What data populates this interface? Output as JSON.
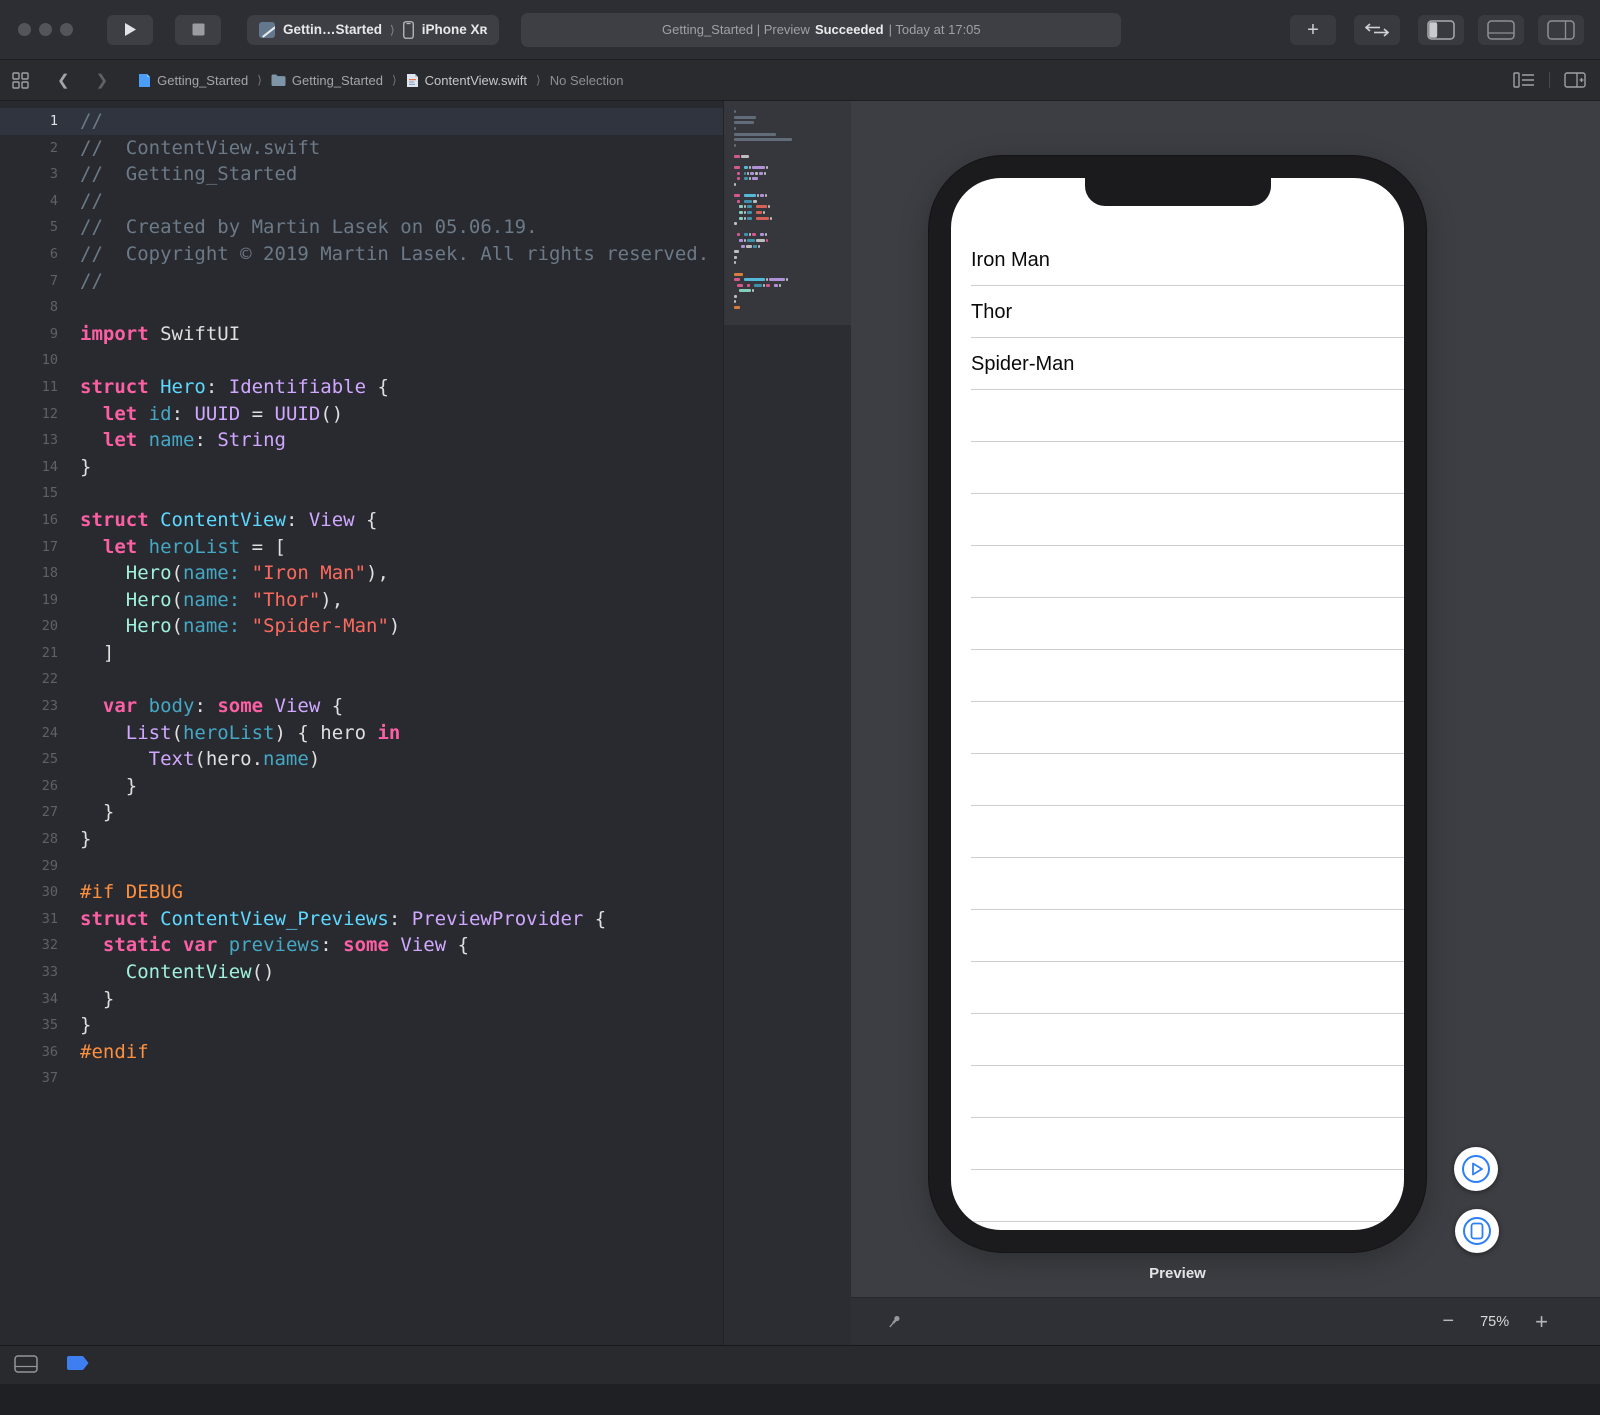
{
  "toolbar": {
    "scheme_app": "Gettin…Started",
    "scheme_chevron": "⟩",
    "scheme_device": "iPhone Xʀ",
    "status_left": "Getting_Started | Preview",
    "status_bold": "Succeeded",
    "status_right": "| Today at 17:05"
  },
  "jumpbar": {
    "back": "❮",
    "forward": "❯",
    "sep": "⟩",
    "crumb_project": "Getting_Started",
    "crumb_group": "Getting_Started",
    "crumb_file": "ContentView.swift",
    "crumb_selection": "No Selection"
  },
  "editor": {
    "current_line": 1,
    "lines": [
      {
        "n": 1,
        "t": [
          [
            "c",
            "//"
          ]
        ]
      },
      {
        "n": 2,
        "t": [
          [
            "c",
            "//  ContentView.swift"
          ]
        ]
      },
      {
        "n": 3,
        "t": [
          [
            "c",
            "//  Getting_Started"
          ]
        ]
      },
      {
        "n": 4,
        "t": [
          [
            "c",
            "//"
          ]
        ]
      },
      {
        "n": 5,
        "t": [
          [
            "c",
            "//  Created by Martin Lasek on 05.06.19."
          ]
        ]
      },
      {
        "n": 6,
        "t": [
          [
            "c",
            "//  Copyright © 2019 Martin Lasek. All rights reserved."
          ]
        ]
      },
      {
        "n": 7,
        "t": [
          [
            "c",
            "//"
          ]
        ]
      },
      {
        "n": 8,
        "t": []
      },
      {
        "n": 9,
        "t": [
          [
            "k",
            "import"
          ],
          [
            "p",
            " SwiftUI"
          ]
        ]
      },
      {
        "n": 10,
        "t": []
      },
      {
        "n": 11,
        "t": [
          [
            "k",
            "struct"
          ],
          [
            "p",
            " "
          ],
          [
            "m",
            "Hero"
          ],
          [
            "p",
            ": "
          ],
          [
            "t",
            "Identifiable"
          ],
          [
            "p",
            " {"
          ]
        ]
      },
      {
        "n": 12,
        "t": [
          [
            "p",
            "  "
          ],
          [
            "k",
            "let"
          ],
          [
            "p",
            " "
          ],
          [
            "v",
            "id"
          ],
          [
            "p",
            ": "
          ],
          [
            "t",
            "UUID"
          ],
          [
            "p",
            " = "
          ],
          [
            "t",
            "UUID"
          ],
          [
            "p",
            "()"
          ]
        ]
      },
      {
        "n": 13,
        "t": [
          [
            "p",
            "  "
          ],
          [
            "k",
            "let"
          ],
          [
            "p",
            " "
          ],
          [
            "v",
            "name"
          ],
          [
            "p",
            ": "
          ],
          [
            "t",
            "String"
          ]
        ]
      },
      {
        "n": 14,
        "t": [
          [
            "p",
            "}"
          ]
        ]
      },
      {
        "n": 15,
        "t": []
      },
      {
        "n": 16,
        "t": [
          [
            "k",
            "struct"
          ],
          [
            "p",
            " "
          ],
          [
            "m",
            "ContentView"
          ],
          [
            "p",
            ": "
          ],
          [
            "t",
            "View"
          ],
          [
            "p",
            " {"
          ]
        ]
      },
      {
        "n": 17,
        "t": [
          [
            "p",
            "  "
          ],
          [
            "k",
            "let"
          ],
          [
            "p",
            " "
          ],
          [
            "v",
            "heroList"
          ],
          [
            "p",
            " = ["
          ]
        ]
      },
      {
        "n": 18,
        "t": [
          [
            "p",
            "    "
          ],
          [
            "u",
            "Hero"
          ],
          [
            "p",
            "("
          ],
          [
            "v",
            "name:"
          ],
          [
            "p",
            " "
          ],
          [
            "s",
            "\"Iron Man\""
          ],
          [
            "p",
            "),"
          ]
        ]
      },
      {
        "n": 19,
        "t": [
          [
            "p",
            "    "
          ],
          [
            "u",
            "Hero"
          ],
          [
            "p",
            "("
          ],
          [
            "v",
            "name:"
          ],
          [
            "p",
            " "
          ],
          [
            "s",
            "\"Thor\""
          ],
          [
            "p",
            "),"
          ]
        ]
      },
      {
        "n": 20,
        "t": [
          [
            "p",
            "    "
          ],
          [
            "u",
            "Hero"
          ],
          [
            "p",
            "("
          ],
          [
            "v",
            "name:"
          ],
          [
            "p",
            " "
          ],
          [
            "s",
            "\"Spider-Man\""
          ],
          [
            "p",
            ")"
          ]
        ]
      },
      {
        "n": 21,
        "t": [
          [
            "p",
            "  ]"
          ]
        ]
      },
      {
        "n": 22,
        "t": []
      },
      {
        "n": 23,
        "t": [
          [
            "p",
            "  "
          ],
          [
            "k",
            "var"
          ],
          [
            "p",
            " "
          ],
          [
            "v",
            "body"
          ],
          [
            "p",
            ": "
          ],
          [
            "k",
            "some"
          ],
          [
            "p",
            " "
          ],
          [
            "t",
            "View"
          ],
          [
            "p",
            " {"
          ]
        ]
      },
      {
        "n": 24,
        "t": [
          [
            "p",
            "    "
          ],
          [
            "t",
            "List"
          ],
          [
            "p",
            "("
          ],
          [
            "v",
            "heroList"
          ],
          [
            "p",
            ") { hero "
          ],
          [
            "k",
            "in"
          ]
        ]
      },
      {
        "n": 25,
        "t": [
          [
            "p",
            "      "
          ],
          [
            "t",
            "Text"
          ],
          [
            "p",
            "(hero."
          ],
          [
            "v",
            "name"
          ],
          [
            "p",
            ")"
          ]
        ]
      },
      {
        "n": 26,
        "t": [
          [
            "p",
            "    }"
          ]
        ]
      },
      {
        "n": 27,
        "t": [
          [
            "p",
            "  }"
          ]
        ]
      },
      {
        "n": 28,
        "t": [
          [
            "p",
            "}"
          ]
        ]
      },
      {
        "n": 29,
        "t": []
      },
      {
        "n": 30,
        "t": [
          [
            "d",
            "#if DEBUG"
          ]
        ]
      },
      {
        "n": 31,
        "t": [
          [
            "k",
            "struct"
          ],
          [
            "p",
            " "
          ],
          [
            "m",
            "ContentView_Previews"
          ],
          [
            "p",
            ": "
          ],
          [
            "t",
            "PreviewProvider"
          ],
          [
            "p",
            " {"
          ]
        ]
      },
      {
        "n": 32,
        "t": [
          [
            "p",
            "  "
          ],
          [
            "k",
            "static"
          ],
          [
            "p",
            " "
          ],
          [
            "k",
            "var"
          ],
          [
            "p",
            " "
          ],
          [
            "v",
            "previews"
          ],
          [
            "p",
            ": "
          ],
          [
            "k",
            "some"
          ],
          [
            "p",
            " "
          ],
          [
            "t",
            "View"
          ],
          [
            "p",
            " {"
          ]
        ]
      },
      {
        "n": 33,
        "t": [
          [
            "p",
            "    "
          ],
          [
            "u",
            "ContentView"
          ],
          [
            "p",
            "()"
          ]
        ]
      },
      {
        "n": 34,
        "t": [
          [
            "p",
            "  }"
          ]
        ]
      },
      {
        "n": 35,
        "t": [
          [
            "p",
            "}"
          ]
        ]
      },
      {
        "n": 36,
        "t": [
          [
            "d",
            "#endif"
          ]
        ]
      },
      {
        "n": 37,
        "t": []
      }
    ]
  },
  "canvas": {
    "device_rows": [
      "Iron Man",
      "Thor",
      "Spider-Man"
    ],
    "empty_rows": 16,
    "preview_label": "Preview",
    "zoom_minus": "−",
    "zoom_level": "75%",
    "zoom_plus": "+"
  },
  "colors": {
    "keyword": "#fc5fa3",
    "string": "#fc6a5d",
    "comment": "#6c7986",
    "other_type": "#d0a8ff",
    "decl_type": "#5dd8ff",
    "project_usage": "#9ef1dd",
    "variable": "#44a8c4",
    "preprocessor": "#fd8f3f",
    "accent_blue": "#2d7ff5",
    "editor_bg": "#292a30",
    "canvas_bg": "#3d3e43"
  }
}
